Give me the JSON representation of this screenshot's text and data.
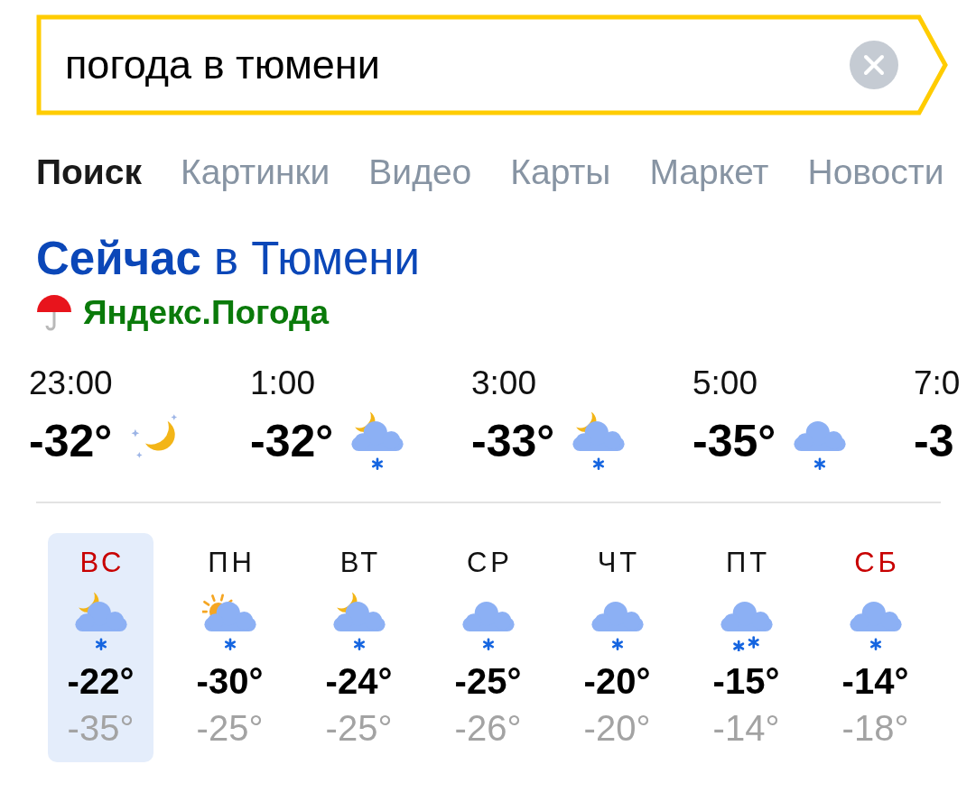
{
  "search": {
    "value": "погода в тюмени"
  },
  "tabs": [
    {
      "label": "Поиск",
      "selected": true
    },
    {
      "label": "Картинки",
      "selected": false
    },
    {
      "label": "Видео",
      "selected": false
    },
    {
      "label": "Карты",
      "selected": false
    },
    {
      "label": "Маркет",
      "selected": false
    },
    {
      "label": "Новости",
      "selected": false
    }
  ],
  "weather": {
    "title": "**Сейчас** в Тюмени",
    "source": "Яндекс.Погода",
    "hourly": [
      {
        "time": "23:00",
        "temp": "-32°",
        "kind": "moonstars"
      },
      {
        "time": "1:00",
        "temp": "-32°",
        "kind": "mooncloudsnow"
      },
      {
        "time": "3:00",
        "temp": "-33°",
        "kind": "mooncloudsnow"
      },
      {
        "time": "5:00",
        "temp": "-35°",
        "kind": "cloudsnow"
      },
      {
        "time": "7:0",
        "temp": "-3"
      }
    ],
    "daily": [
      {
        "day": "ВС",
        "weekend": true,
        "selected": true,
        "kind": "mooncloudsnow",
        "max": "-22°",
        "min": "-35°"
      },
      {
        "day": "ПН",
        "weekend": false,
        "selected": false,
        "kind": "suncloudsnow",
        "max": "-30°",
        "min": "-25°"
      },
      {
        "day": "ВТ",
        "weekend": false,
        "selected": false,
        "kind": "mooncloudsnow",
        "max": "-24°",
        "min": "-25°"
      },
      {
        "day": "СР",
        "weekend": false,
        "selected": false,
        "kind": "cloudsnow",
        "max": "-25°",
        "min": "-26°"
      },
      {
        "day": "ЧТ",
        "weekend": false,
        "selected": false,
        "kind": "cloudsnow",
        "max": "-20°",
        "min": "-20°"
      },
      {
        "day": "ПТ",
        "weekend": false,
        "selected": false,
        "kind": "cloudheavysnow",
        "max": "-15°",
        "min": "-14°"
      },
      {
        "day": "СБ",
        "weekend": true,
        "selected": false,
        "kind": "cloudsnow",
        "max": "-14°",
        "min": "-18°"
      }
    ]
  }
}
